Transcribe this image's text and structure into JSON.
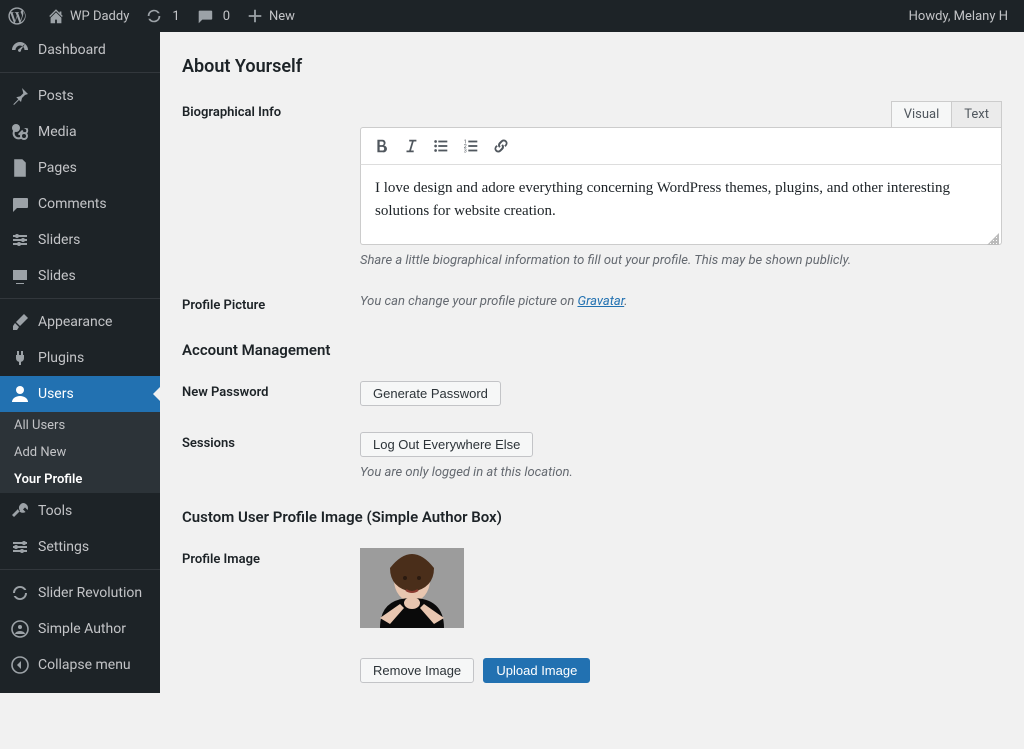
{
  "adminbar": {
    "site_name": "WP Daddy",
    "updates": "1",
    "comments": "0",
    "new_label": "New",
    "howdy": "Howdy, Melany H"
  },
  "menu": {
    "dashboard": "Dashboard",
    "posts": "Posts",
    "media": "Media",
    "pages": "Pages",
    "comments": "Comments",
    "sliders": "Sliders",
    "slides": "Slides",
    "appearance": "Appearance",
    "plugins": "Plugins",
    "users": "Users",
    "users_sub": {
      "all": "All Users",
      "add": "Add New",
      "profile": "Your Profile"
    },
    "tools": "Tools",
    "settings": "Settings",
    "slider_revolution": "Slider Revolution",
    "simple_author": "Simple Author",
    "collapse": "Collapse menu"
  },
  "section": {
    "about": "About Yourself",
    "bio_label": "Biographical Info",
    "visual": "Visual",
    "text": "Text",
    "bio_value": "I love design and adore everything concerning WordPress themes, plugins, and other interesting solutions for website creation.",
    "bio_help": "Share a little biographical information to fill out your profile. This may be shown publicly.",
    "picture_label": "Profile Picture",
    "picture_help_pre": "You can change your profile picture on ",
    "picture_help_link": "Gravatar",
    "account": "Account Management",
    "newpw_label": "New Password",
    "newpw_btn": "Generate Password",
    "sessions_label": "Sessions",
    "sessions_btn": "Log Out Everywhere Else",
    "sessions_help": "You are only logged in at this location.",
    "custom": "Custom User Profile Image (Simple Author Box)",
    "pimg_label": "Profile Image",
    "remove_btn": "Remove Image",
    "upload_btn": "Upload Image"
  }
}
